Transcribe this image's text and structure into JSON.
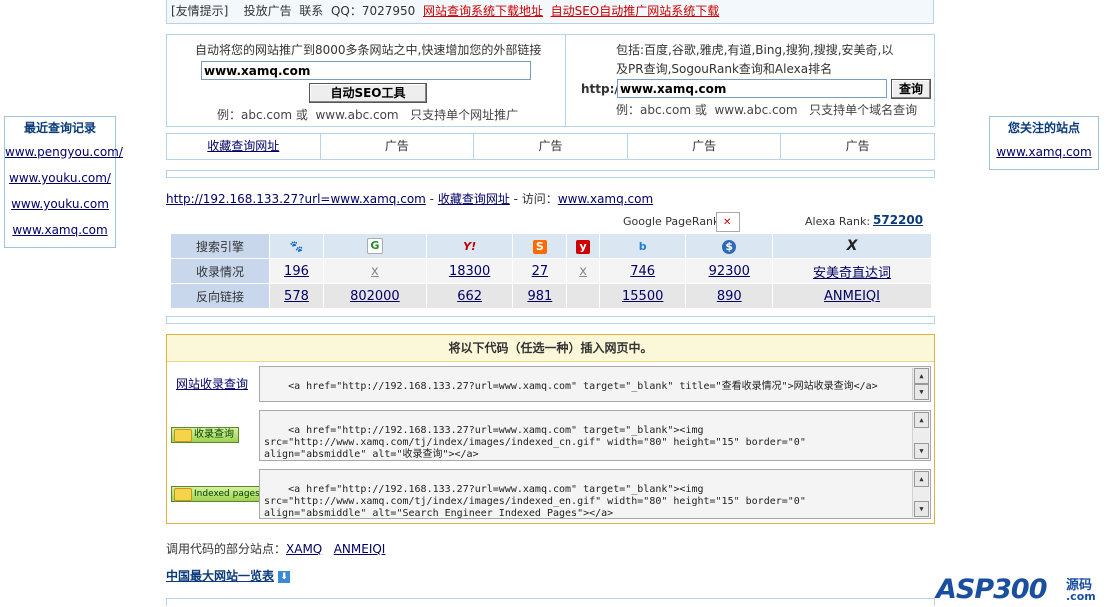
{
  "topbar": {
    "notice": "[友情提示]",
    "ad": "投放广告",
    "contact": "联系",
    "qq": "QQ：7027950",
    "link1": "网站查询系统下载地址",
    "link2": "自动SEO自动推广网站系统下载"
  },
  "promo": {
    "desc": "自动将您的网站推广到8000多条网站之中,快速增加您的外部链接",
    "input_value": "www.xamq.com",
    "button": "自动SEO工具",
    "example": "例：abc.com 或  www.abc.com   只支持单个网址推广"
  },
  "query": {
    "desc1": "包括:百度,谷歌,雅虎,有道,Bing,搜狗,搜搜,安美奇,以",
    "desc2": "及PR查询,SogouRank查询和Alexa排名",
    "prefix": "http://",
    "input_value": "www.xamq.com",
    "button": "查询",
    "example": "例：abc.com 或  www.abc.com   只支持单个域名查询"
  },
  "recent": {
    "title": "最近查询记录",
    "items": [
      "www.pengyou.com/",
      "www.youku.com/",
      "www.youku.com",
      "www.xamq.com"
    ]
  },
  "watched": {
    "title": "您关注的站点",
    "items": [
      "www.xamq.com"
    ]
  },
  "adrow": [
    "收藏查询网址",
    "广告",
    "广告",
    "广告",
    "广告"
  ],
  "urlline": {
    "url": "http://192.168.133.27?url=www.xamq.com",
    "sep1": " - ",
    "fav": "收藏查询网址",
    "visit": " - 访问：",
    "site": "www.xamq.com"
  },
  "ranks": {
    "pr_label": "Google PageRank:",
    "alexa_label": "Alexa Rank:",
    "alexa_value": "572200"
  },
  "table": {
    "row_labels": [
      "搜索引擎",
      "收录情况",
      "反向链接"
    ],
    "engines": [
      {
        "icon": "baidu-paw-icon",
        "glyph": "🐾",
        "color": "#2a4db8"
      },
      {
        "icon": "google-g-icon",
        "glyph": "G",
        "color": "#2a8a2a"
      },
      {
        "icon": "yahoo-y-icon",
        "glyph": "Y!",
        "color": "#c00000"
      },
      {
        "icon": "sogou-s-icon",
        "glyph": "S",
        "color": "#ff6a00"
      },
      {
        "icon": "youdao-y-icon",
        "glyph": "y",
        "color": "#cc0000"
      },
      {
        "icon": "bing-b-icon",
        "glyph": "b",
        "color": "#1c7fd0"
      },
      {
        "icon": "soso-s-icon",
        "glyph": "$",
        "color": "#2f68b5"
      },
      {
        "icon": "anmeiqi-x-icon",
        "glyph": "X",
        "color": "#222222"
      }
    ],
    "indexed": [
      "196",
      "x",
      "18300",
      "27",
      "x",
      "746",
      "92300",
      "安美奇直达词"
    ],
    "backlinks": [
      "578",
      "802000",
      "662",
      "981",
      "",
      "15500",
      "890",
      "ANMEIQI"
    ]
  },
  "code": {
    "header": "将以下代码（任选一种）插入网页中。",
    "link_label": "网站收录查询",
    "badge_cn": "收录查询",
    "badge_en": "Indexed pages",
    "code1": "<a href=\"http://192.168.133.27?url=www.xamq.com\" target=\"_blank\" title=\"查看收录情况\">网站收录查询</a>",
    "code2": "<a href=\"http://192.168.133.27?url=www.xamq.com\" target=\"_blank\"><img\nsrc=\"http://www.xamq.com/tj/index/images/indexed_cn.gif\" width=\"80\" height=\"15\" border=\"0\"\nalign=\"absmiddle\" alt=\"收录查询\"></a>",
    "code3": "<a href=\"http://192.168.133.27?url=www.xamq.com\" target=\"_blank\"><img\nsrc=\"http://www.xamq.com/tj/index/images/indexed_en.gif\" width=\"80\" height=\"15\" border=\"0\"\nalign=\"absmiddle\" alt=\"Search Engineer Indexed Pages\"></a>"
  },
  "footer": {
    "sites_label": "调用代码的部分站点：",
    "site1": "XAMQ",
    "site2": "ANMEIQI",
    "biglink": "中国最大网站一览表",
    "logo_main": "ASP300",
    "logo_side": "源码",
    "logo_dom": ".com"
  }
}
